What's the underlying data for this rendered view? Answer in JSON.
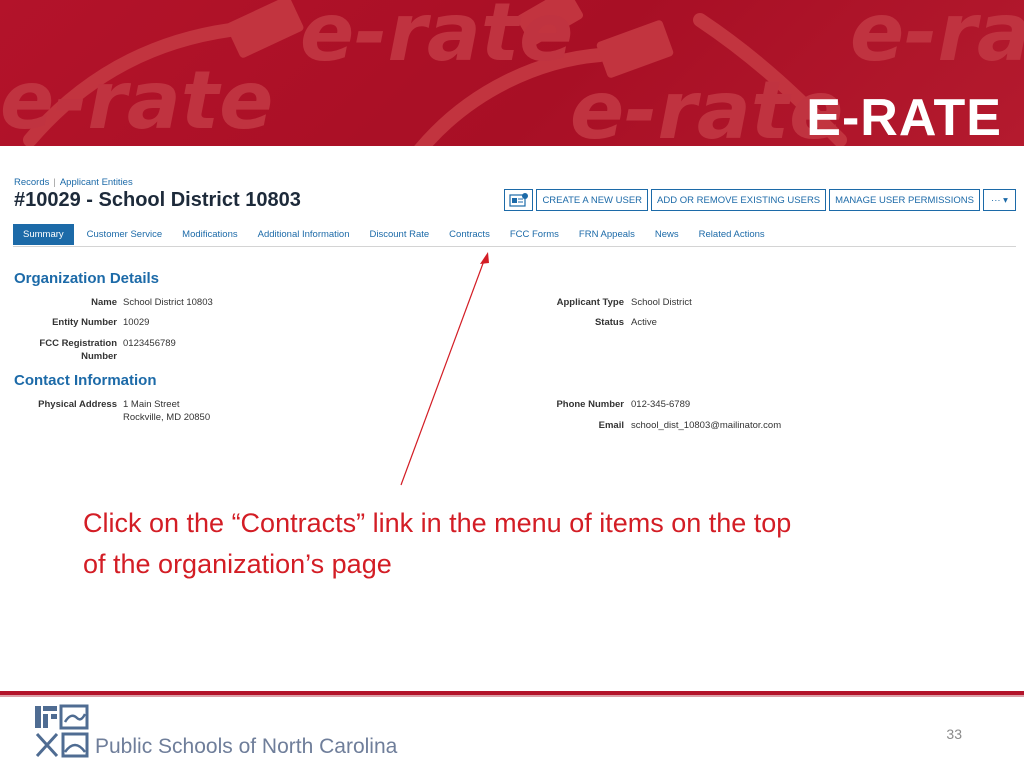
{
  "banner": {
    "title": "E-RATE",
    "watermark_text": "e-rate"
  },
  "breadcrumb": {
    "items": [
      "Records",
      "Applicant Entities"
    ]
  },
  "page_title": "#10029 - School District 10803",
  "actions": {
    "create_user": "CREATE A NEW USER",
    "add_remove_users": "ADD OR REMOVE EXISTING USERS",
    "manage_permissions": "MANAGE USER PERMISSIONS",
    "more": "··· ▾"
  },
  "tabs": [
    "Summary",
    "Customer Service",
    "Modifications",
    "Additional Information",
    "Discount Rate",
    "Contracts",
    "FCC Forms",
    "FRN Appeals",
    "News",
    "Related Actions"
  ],
  "organization": {
    "heading": "Organization Details",
    "name_label": "Name",
    "name_value": "School District 10803",
    "entity_label": "Entity Number",
    "entity_value": "10029",
    "fcc_label_1": "FCC Registration",
    "fcc_label_2": "Number",
    "fcc_value": "0123456789",
    "applicant_type_label": "Applicant Type",
    "applicant_type_value": "School District",
    "status_label": "Status",
    "status_value": "Active"
  },
  "contact": {
    "heading": "Contact Information",
    "address_label": "Physical Address",
    "address_line1": "1 Main Street",
    "address_line2": "Rockville, MD 20850",
    "phone_label": "Phone Number",
    "phone_value": "012-345-6789",
    "email_label": "Email",
    "email_value": "school_dist_10803@mailinator.com"
  },
  "instruction": {
    "line1": "Click on the “Contracts” link in the menu of items on the top",
    "line2": "of the organization’s page"
  },
  "footer": {
    "org_name": "Public Schools of North Carolina",
    "page_number": "33"
  },
  "colors": {
    "banner_red": "#b3132a",
    "link_blue": "#1c6aa8",
    "instruction_red": "#d31d25",
    "footer_text": "#6f7e9a"
  }
}
